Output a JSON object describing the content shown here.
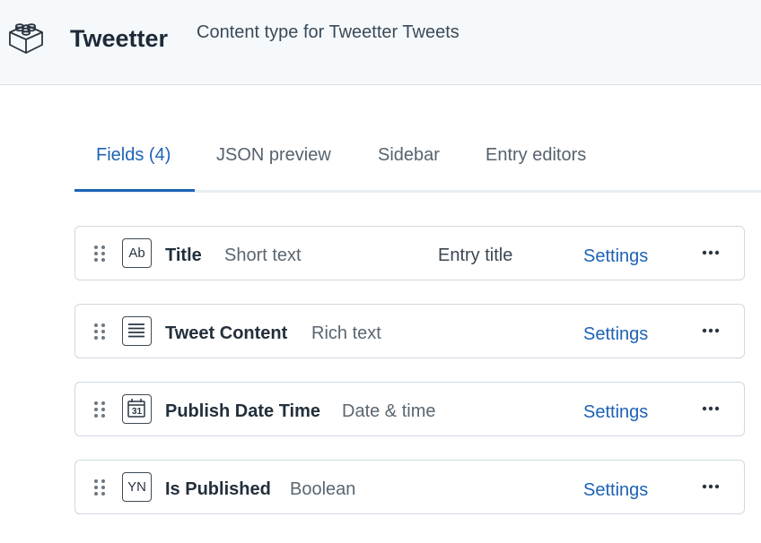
{
  "header": {
    "logo_icon": "content-type-block-icon",
    "title": "Tweetter",
    "description": "Content type for Tweetter Tweets"
  },
  "tabs": [
    {
      "label": "Fields (4)",
      "active": true
    },
    {
      "label": "JSON preview",
      "active": false
    },
    {
      "label": "Sidebar",
      "active": false
    },
    {
      "label": "Entry editors",
      "active": false
    }
  ],
  "fields": [
    {
      "icon": "short-text-icon",
      "icon_text": "Ab",
      "name": "Title",
      "type": "Short text",
      "extra": "Entry title",
      "settings_label": "Settings"
    },
    {
      "icon": "rich-text-icon",
      "icon_text": "",
      "name": "Tweet Content",
      "type": "Rich text",
      "extra": "",
      "settings_label": "Settings"
    },
    {
      "icon": "calendar-icon",
      "icon_text": "31",
      "name": "Publish Date Time",
      "type": "Date & time",
      "extra": "",
      "settings_label": "Settings"
    },
    {
      "icon": "boolean-icon",
      "icon_text": "YN",
      "name": "Is Published",
      "type": "Boolean",
      "extra": "",
      "settings_label": "Settings"
    }
  ],
  "colors": {
    "accent": "#1d63b5",
    "header_bg": "#f6f9fb",
    "border": "#cfd9e0"
  }
}
